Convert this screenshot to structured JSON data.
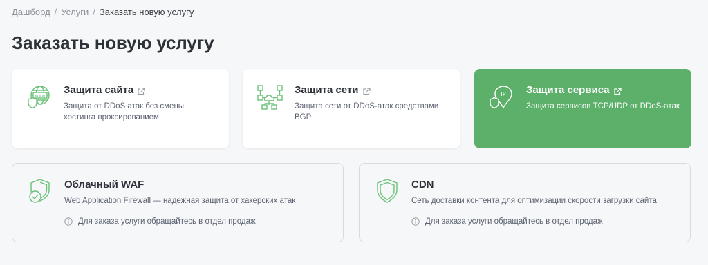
{
  "breadcrumb": {
    "items": [
      "Дашборд",
      "Услуги",
      "Заказать новую услугу"
    ],
    "separator": "/"
  },
  "page_title": "Заказать новую услугу",
  "cards": [
    {
      "title": "Защита сайта",
      "description": "Защита от DDoS атак без смены хостинга проксированием",
      "icon": "globe-shield-icon",
      "external": true
    },
    {
      "title": "Защита сети",
      "description": "Защита сети от DDoS-атак средствами BGP",
      "icon": "network-icon",
      "external": true
    },
    {
      "title": "Защита сервиса",
      "description": "Защита сервисов TCP/UDP от DDoS-атак",
      "icon": "ip-shield-icon",
      "external": true,
      "active": true
    },
    {
      "title": "Облачный WAF",
      "description": "Web Application Firewall — надежная защита от хакерских атак",
      "note": "Для заказа услуги обращайтесь в отдел продаж",
      "icon": "shield-check-icon",
      "disabled": true
    },
    {
      "title": "CDN",
      "description": "Сеть доставки контента для оптимизации скорости загрузки сайта",
      "note": "Для заказа услуги обращайтесь в отдел продаж",
      "icon": "shield-icon",
      "disabled": true
    }
  ],
  "colors": {
    "accent": "#5cb06a",
    "icon_green": "#6cc07a",
    "background": "#f6f7f9"
  }
}
